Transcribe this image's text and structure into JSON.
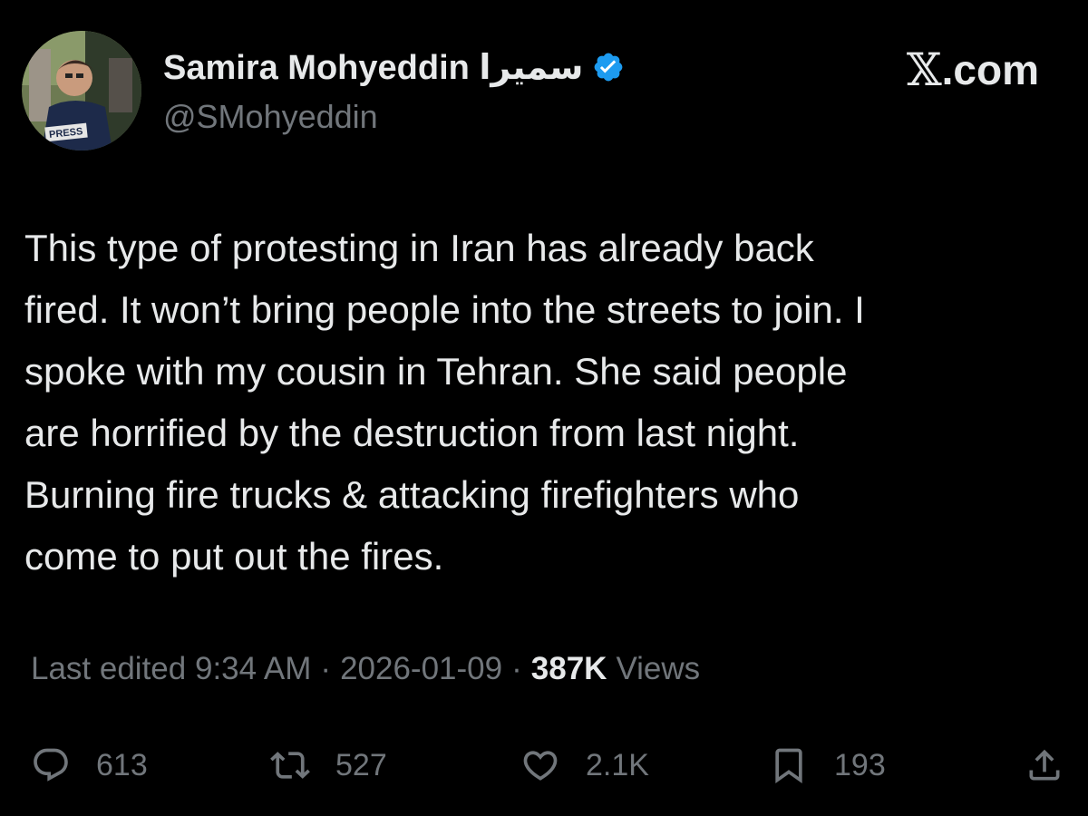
{
  "author": {
    "display_name": "Samira Mohyeddin سمیرا",
    "handle": "@SMohyeddin",
    "verified": true,
    "avatar_badge_text": "PRESS"
  },
  "site": {
    "logo_text": ".com",
    "logo_glyph": "𝕏"
  },
  "tweet": {
    "lines": [
      "This type of protesting in Iran has already back",
      "fired. It won’t bring people into the streets to join. I",
      "spoke with my cousin in Tehran. She said people",
      "are horrified by the destruction from last night.",
      "Burning fire trucks & attacking firefighters who",
      "come to put out the fires."
    ]
  },
  "meta": {
    "edited_prefix": "Last edited",
    "time": "9:34 AM",
    "separator": "·",
    "date": "2026-01-09",
    "views_count": "387K",
    "views_label": "Views"
  },
  "actions": {
    "replies": "613",
    "reposts": "527",
    "likes": "2.1K",
    "bookmarks": "193"
  },
  "colors": {
    "background": "#000000",
    "text_primary": "#e7e9ea",
    "text_secondary": "#71767b",
    "verified_badge": "#1d9bf0"
  },
  "icons": [
    "verified-badge-icon",
    "reply-icon",
    "retweet-icon",
    "like-icon",
    "bookmark-icon",
    "share-icon"
  ]
}
